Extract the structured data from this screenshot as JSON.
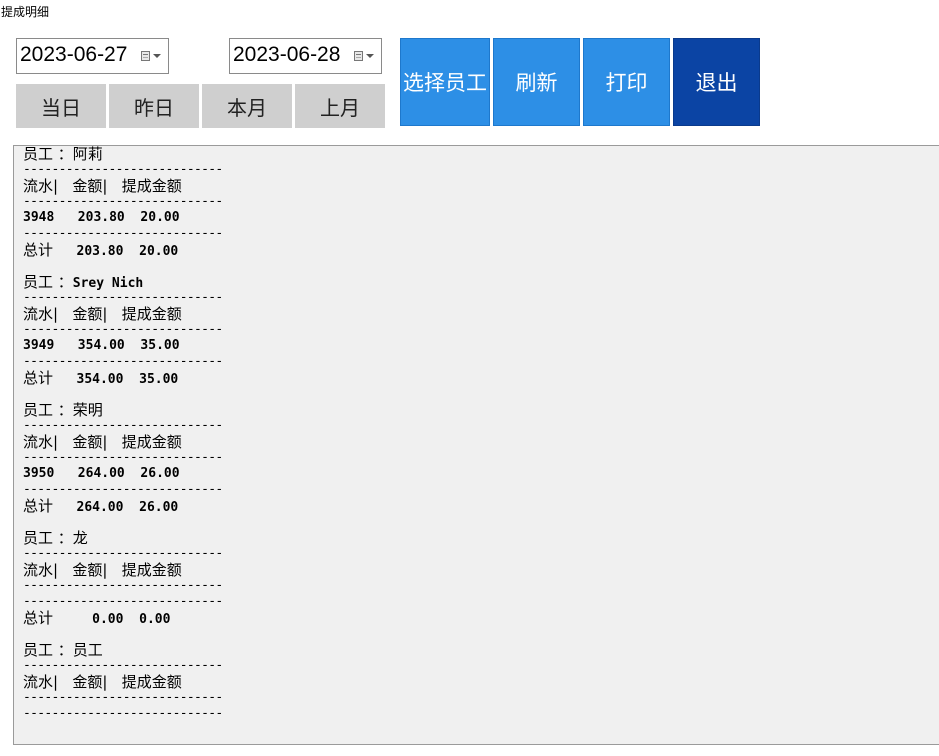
{
  "window": {
    "title": "提成明细"
  },
  "date_range": {
    "start": "2023-06-27",
    "end": "2023-06-28"
  },
  "quick_buttons": [
    "当日",
    "昨日",
    "本月",
    "上月"
  ],
  "actions": {
    "select_employee": "选择员工",
    "refresh": "刷新",
    "print": "打印",
    "exit": "退出"
  },
  "report": {
    "employee_prefix": "员工 ：",
    "header": {
      "serial": "流水|",
      "amount": "金额|",
      "commission": "提成金额"
    },
    "total_label": "总计",
    "separator": "----------------------------",
    "groups": [
      {
        "employee": "阿莉",
        "rows": [
          {
            "serial": "3948",
            "amount": "203.80",
            "commission": "20.00"
          }
        ],
        "total_amount": "203.80",
        "total_commission": "20.00"
      },
      {
        "employee": "Srey Nich",
        "rows": [
          {
            "serial": "3949",
            "amount": "354.00",
            "commission": "35.00"
          }
        ],
        "total_amount": "354.00",
        "total_commission": "35.00"
      },
      {
        "employee": "荣明",
        "rows": [
          {
            "serial": "3950",
            "amount": "264.00",
            "commission": "26.00"
          }
        ],
        "total_amount": "264.00",
        "total_commission": "26.00"
      },
      {
        "employee": "龙",
        "rows": [],
        "total_amount": "0.00",
        "total_commission": "0.00"
      },
      {
        "employee": "员工",
        "rows": [],
        "total_amount": "",
        "total_commission": ""
      }
    ]
  }
}
